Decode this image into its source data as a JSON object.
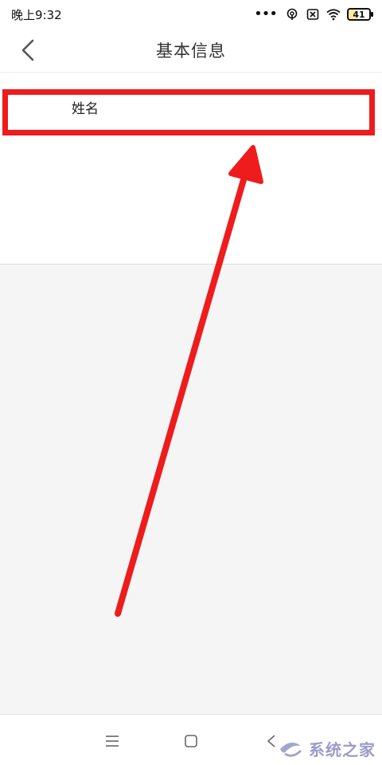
{
  "status_bar": {
    "time": "晚上9:32",
    "dots": "•••",
    "battery_level": "41",
    "icons": [
      "signal-dots-icon",
      "hotspot-icon",
      "sim-off-icon",
      "wifi-icon",
      "battery-icon"
    ]
  },
  "header": {
    "title": "基本信息",
    "back_icon": "chevron-left-icon"
  },
  "form": {
    "name_label": "姓名"
  },
  "annotation": {
    "highlight_color": "#ee1c1c"
  },
  "nav_bar": {
    "icons": [
      "menu-icon",
      "home-icon",
      "back-icon"
    ]
  },
  "watermark": {
    "text": "系统之家"
  }
}
